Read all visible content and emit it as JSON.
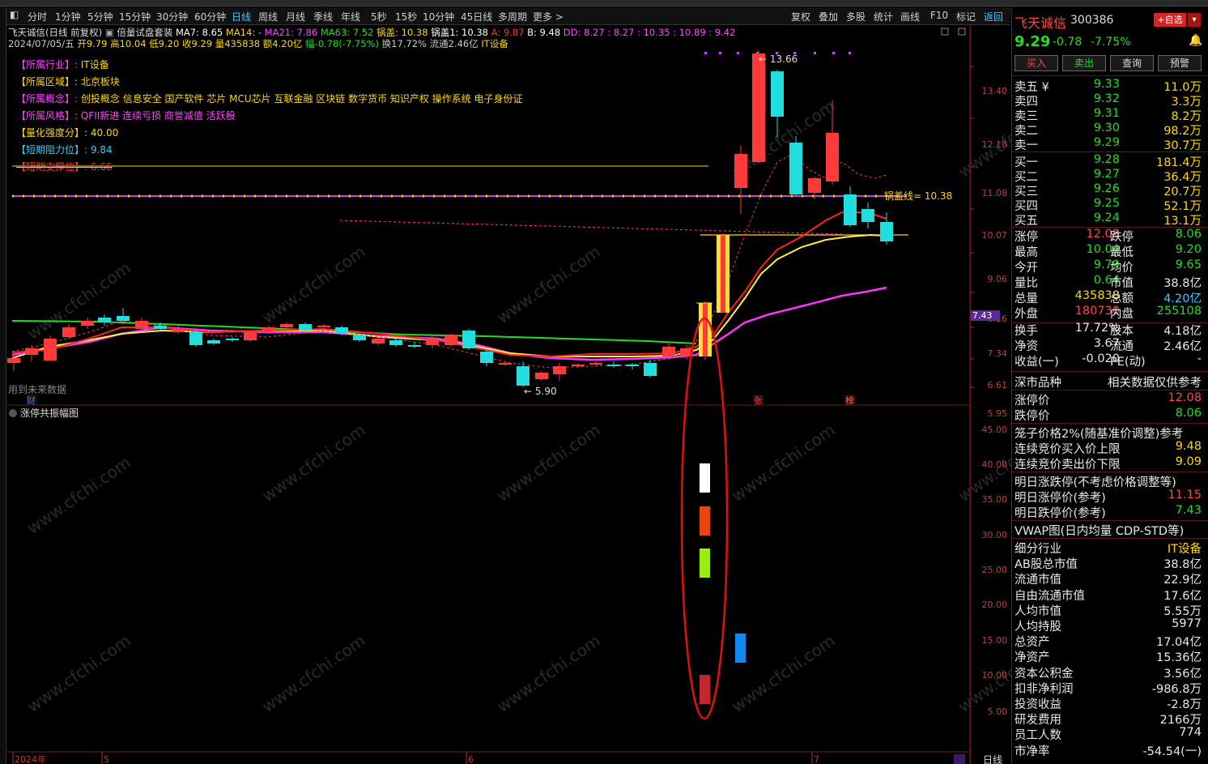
{
  "toolbar": {
    "periods": [
      "分时",
      "1分钟",
      "5分钟",
      "15分钟",
      "30分钟",
      "60分钟",
      "日线",
      "周线",
      "月线",
      "季线",
      "年线",
      "5秒",
      "15秒",
      "10分钟",
      "45日线",
      "多周期",
      "更多 >"
    ],
    "active": "日线",
    "right": [
      "复权",
      "叠加",
      "多股",
      "统计",
      "画线",
      "F10",
      "标记",
      "返回"
    ]
  },
  "chart": {
    "title": "飞天诚信(日线 前复权)",
    "formula": "倍量试盘套装",
    "ma": [
      {
        "t": "MA7: 8.65",
        "c": "#ffffff"
      },
      {
        "t": "MA14: -",
        "c": "#ffd700"
      },
      {
        "t": "MA21: 7.86",
        "c": "#ff44ff"
      },
      {
        "t": "MA63: 7.52",
        "c": "#22dd22"
      },
      {
        "t": "锅盖: 10.38",
        "c": "#ffd700"
      },
      {
        "t": "锅盖1: 10.38",
        "c": "#ffffff"
      },
      {
        "t": "A: 9.87",
        "c": "#ff3333"
      },
      {
        "t": "B: 9.48",
        "c": "#ffffff"
      },
      {
        "t": "DD: 8.27 : 8.27 : 10.35 : 10.89 : 9.42",
        "c": "#ff44ff"
      }
    ],
    "ohlc": [
      {
        "t": "2024/07/05/五",
        "c": "#cccccc"
      },
      {
        "t": "开9.79",
        "c": "#ffd700"
      },
      {
        "t": "高10.04",
        "c": "#ffd700"
      },
      {
        "t": "低9.20",
        "c": "#ffd700"
      },
      {
        "t": "收9.29",
        "c": "#ffd700"
      },
      {
        "t": "量435838",
        "c": "#ffd700"
      },
      {
        "t": "额4.20亿",
        "c": "#ffd700"
      },
      {
        "t": "幅-0.78(-7.75%)",
        "c": "#22dd22"
      },
      {
        "t": "换17.72%",
        "c": "#cccccc"
      },
      {
        "t": "流通2.46亿",
        "c": "#cccccc"
      },
      {
        "t": "IT设备",
        "c": "#ffd700"
      }
    ],
    "info": [
      {
        "k": "【所属行业】:",
        "v": "IT设备",
        "kc": "#ff44ff",
        "vc": "#ffd700"
      },
      {
        "k": "【所属区域】:",
        "v": "北京板块",
        "kc": "#ffd700",
        "vc": "#ffd700"
      },
      {
        "k": "【所属概念】:",
        "v": "创投概念 信息安全 国产软件 芯片 MCU芯片 互联金融 区块链 数字货币 知识产权 操作系统 电子身份证",
        "kc": "#ff44ff",
        "vc": "#ffd700"
      },
      {
        "k": "【所属风格】:",
        "v": "QFII新进 连续亏损 商誉减值 活跃股",
        "kc": "#ff44ff",
        "vc": "#ff44ff"
      },
      {
        "k": "【量化强度分】:",
        "v": "40.00",
        "kc": "#ffd700",
        "vc": "#ffd700"
      },
      {
        "k": "【短期阻力位】:",
        "v": "9.84",
        "kc": "#33ccff",
        "vc": "#33ccff"
      },
      {
        "k": "【短期支撑位】:",
        "v": "6.66",
        "kc": "#ff3333",
        "vc": "#ff3333"
      }
    ],
    "ylabels": [
      "13.40",
      "12.18",
      "11.08",
      "10.07",
      "9.06",
      "8.16",
      "7.34",
      "6.61",
      "5.95"
    ],
    "price_tag": "7.43",
    "hi": "13.66",
    "lo": "5.90",
    "guogai": "锅盖线= 10.38",
    "future": "用到未来数据",
    "markers": {
      "cai": "财",
      "zhang": "张",
      "bang": "榜"
    },
    "sub_title": "涨停共振幅图",
    "sub_ylabels": [
      "45.00",
      "40.00",
      "35.00",
      "30.00",
      "25.00",
      "20.00",
      "15.00",
      "10.00",
      "5.00"
    ],
    "xaxis": {
      "year": "2024年",
      "m5": "5",
      "m6": "6",
      "m7": "7",
      "period": "日线"
    },
    "watermark": "www.cfchi.com"
  },
  "quote": {
    "name": "飞天诚信",
    "code": "300386",
    "add": "+自选",
    "price": "9.29",
    "chg": "-0.78",
    "pct": "-7.75%",
    "buttons": [
      "买入",
      "卖出",
      "查询",
      "预警"
    ]
  },
  "sell": [
    {
      "k": "卖五 ¥",
      "p": "9.33",
      "v": "11.0万"
    },
    {
      "k": "卖四",
      "p": "9.32",
      "v": "3.3万"
    },
    {
      "k": "卖三",
      "p": "9.31",
      "v": "8.2万"
    },
    {
      "k": "卖二",
      "p": "9.30",
      "v": "98.2万"
    },
    {
      "k": "卖一",
      "p": "9.29",
      "v": "30.7万"
    }
  ],
  "buy": [
    {
      "k": "买一",
      "p": "9.28",
      "v": "181.4万"
    },
    {
      "k": "买二",
      "p": "9.27",
      "v": "36.4万"
    },
    {
      "k": "买三",
      "p": "9.26",
      "v": "20.7万"
    },
    {
      "k": "买四",
      "p": "9.25",
      "v": "52.1万"
    },
    {
      "k": "买五",
      "p": "9.24",
      "v": "13.1万"
    }
  ],
  "stats": [
    {
      "k": "涨停",
      "v": "12.08",
      "vc": "#ff4545",
      "k2": "跌停",
      "v2": "8.06",
      "v2c": "#22dd22"
    },
    {
      "k": "最高",
      "v": "10.04",
      "vc": "#22dd22",
      "k2": "最低",
      "v2": "9.20",
      "v2c": "#22dd22"
    },
    {
      "k": "今开",
      "v": "9.79",
      "vc": "#22dd22",
      "k2": "均价",
      "v2": "9.65",
      "v2c": "#22dd22"
    },
    {
      "k": "量比",
      "v": "0.64",
      "vc": "#22dd22",
      "k2": "市值",
      "v2": "38.8亿",
      "v2c": "#e8e8e8"
    },
    {
      "k": "总量",
      "v": "435838",
      "vc": "#ffd700",
      "k2": "总额",
      "v2": "4.20亿",
      "v2c": "#33ccff"
    },
    {
      "k": "外盘",
      "v": "180730",
      "vc": "#ff4545",
      "k2": "内盘",
      "v2": "255108",
      "v2c": "#22dd22"
    },
    {
      "k": "换手",
      "v": "17.72%",
      "vc": "#e8e8e8",
      "k2": "股本",
      "v2": "4.18亿",
      "v2c": "#e8e8e8"
    },
    {
      "k": "净资",
      "v": "3.67",
      "vc": "#e8e8e8",
      "k2": "流通",
      "v2": "2.46亿",
      "v2c": "#e8e8e8"
    },
    {
      "k": "收益(一)",
      "v": "-0.020",
      "vc": "#e8e8e8",
      "k2": "PE(动)",
      "v2": "-",
      "v2c": "#e8e8e8"
    }
  ],
  "sz": {
    "k": "深市品种",
    "v": "相关数据仅供参考"
  },
  "limits": [
    {
      "k": "涨停价",
      "v": "12.08",
      "c": "#ff4545"
    },
    {
      "k": "跌停价",
      "v": "8.06",
      "c": "#22dd22"
    }
  ],
  "cage": {
    "title": "笼子价格2%(随基准价调整)参考",
    "rows": [
      {
        "k": "连续竞价买入价上限",
        "v": "9.48",
        "c": "#ffd700"
      },
      {
        "k": "连续竞价卖出价下限",
        "v": "9.09",
        "c": "#ffd700"
      }
    ]
  },
  "tomorrow": {
    "title": "明日涨跌停(不考虑价格调整等)",
    "rows": [
      {
        "k": "明日涨停价(参考)",
        "v": "11.15",
        "c": "#ff4545"
      },
      {
        "k": "明日跌停价(参考)",
        "v": "7.43",
        "c": "#22dd22"
      }
    ]
  },
  "vwap": "VWAP图(日内均量 CDP-STD等)",
  "fund": [
    {
      "k": "细分行业",
      "v": "IT设备",
      "c": "#ffd700"
    },
    {
      "k": "AB股总市值",
      "v": "38.8亿",
      "c": "#e8e8e8"
    },
    {
      "k": "流通市值",
      "v": "22.9亿",
      "c": "#e8e8e8"
    },
    {
      "k": "自由流通市值",
      "v": "17.6亿",
      "c": "#e8e8e8"
    },
    {
      "k": "人均市值",
      "v": "5.55万",
      "c": "#e8e8e8"
    },
    {
      "k": "人均持股",
      "v": "5977",
      "c": "#e8e8e8"
    },
    {
      "k": "总资产",
      "v": "17.04亿",
      "c": "#e8e8e8"
    },
    {
      "k": "净资产",
      "v": "15.36亿",
      "c": "#e8e8e8"
    },
    {
      "k": "资本公积金",
      "v": "3.56亿",
      "c": "#e8e8e8"
    },
    {
      "k": "扣非净利润",
      "v": "-986.8万",
      "c": "#e8e8e8"
    },
    {
      "k": "投资收益",
      "v": "-2.8万",
      "c": "#e8e8e8"
    },
    {
      "k": "研发费用",
      "v": "2166万",
      "c": "#e8e8e8"
    },
    {
      "k": "员工人数",
      "v": "774",
      "c": "#e8e8e8"
    },
    {
      "k": "市净率",
      "v": "-54.54(一)",
      "c": "#e8e8e8"
    }
  ],
  "colors": {
    "up": "#ff3a3a",
    "down": "#22dddd",
    "ma_short": "#ff2020",
    "ma_mid": "#ffee44",
    "ma_long": "#ff33ff",
    "ma_green": "#22dd22"
  }
}
